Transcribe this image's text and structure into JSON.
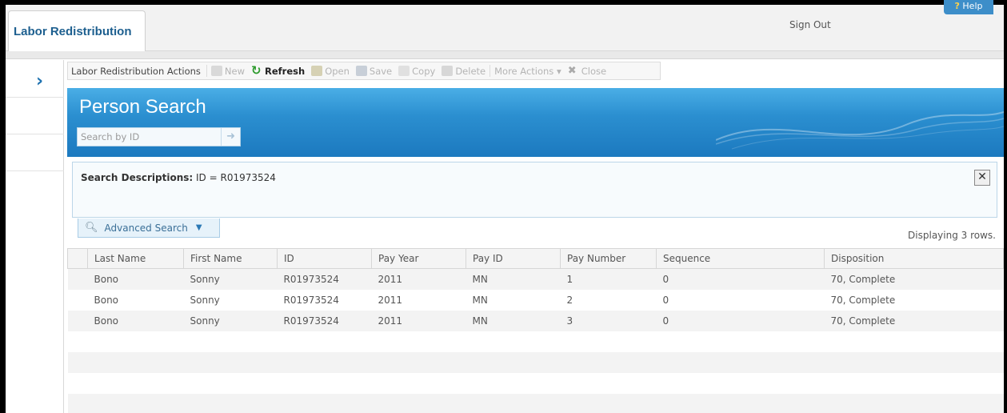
{
  "header": {
    "app_tab": "Labor Redistribution",
    "sign_out": "Sign Out",
    "help": "Help"
  },
  "rail": {
    "expand_icon": "chevron-right"
  },
  "toolbar": {
    "title": "Labor Redistribution Actions",
    "new": "New",
    "refresh": "Refresh",
    "open": "Open",
    "save": "Save",
    "copy": "Copy",
    "delete": "Delete",
    "more_actions": "More Actions",
    "close": "Close"
  },
  "banner": {
    "title": "Person Search",
    "search_placeholder": "Search by ID"
  },
  "search_description": {
    "label": "Search Descriptions:",
    "value": "ID = R01973524"
  },
  "advanced_search": {
    "label": "Advanced Search"
  },
  "row_count": "Displaying 3 rows.",
  "table": {
    "columns": [
      "Last Name",
      "First Name",
      "ID",
      "Pay Year",
      "Pay ID",
      "Pay Number",
      "Sequence",
      "Disposition"
    ],
    "rows": [
      [
        "Bono",
        "Sonny",
        "R01973524",
        "2011",
        "MN",
        "1",
        "0",
        "70, Complete"
      ],
      [
        "Bono",
        "Sonny",
        "R01973524",
        "2011",
        "MN",
        "2",
        "0",
        "70, Complete"
      ],
      [
        "Bono",
        "Sonny",
        "R01973524",
        "2011",
        "MN",
        "3",
        "0",
        "70, Complete"
      ]
    ]
  },
  "colors": {
    "accent": "#1f72b0",
    "banner": "#2b8fd0"
  }
}
